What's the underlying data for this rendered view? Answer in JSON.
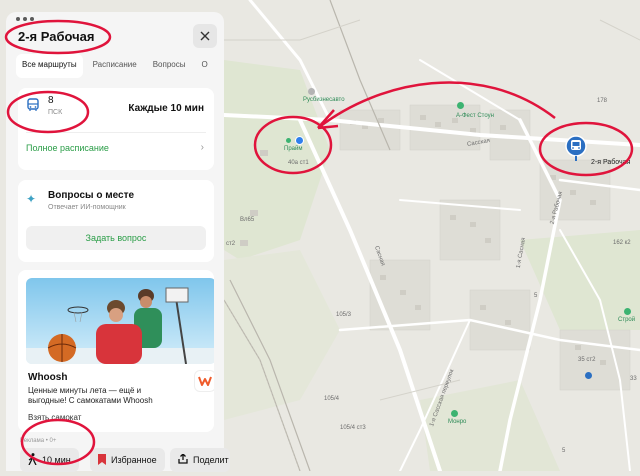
{
  "panel": {
    "title": "2-я Рабочая",
    "tabs": [
      "Все маршруты",
      "Расписание",
      "Вопросы",
      "О"
    ],
    "route": {
      "number": "8",
      "type": "ПСК",
      "frequency": "Каждые 10 мин",
      "schedule_link": "Полное расписание"
    },
    "questions": {
      "title": "Вопросы о месте",
      "subtitle": "Отвечает ИИ-помощник",
      "button": "Задать вопрос"
    },
    "ad": {
      "title": "Whoosh",
      "text": "Ценные минуты лета — ещё и выгодные! С самокатами Whoosh",
      "link": "Взять самокат",
      "note": "Реклама • 0+"
    },
    "bottom": {
      "walk": "10 мин",
      "favorite": "Избранное",
      "share": "Поделит"
    }
  },
  "map": {
    "labels": {
      "rusbiz": "Русбизнесавто",
      "praim": "Прайм",
      "house40a": "40а ст1",
      "afest": "А-Фест Стоун",
      "house178": "178",
      "stop_name": "2-я Рабочая",
      "house65": "Вл65",
      "street1": "Сасная",
      "street2": "Сасская",
      "street3": "2-я Рабочая",
      "street4": "1-я Сасная",
      "street5": "1-я Сасская переулок",
      "house1": "105/3",
      "house2": "105/4",
      "house3": "105/4 ст3",
      "house4": "35 ст2",
      "house5": "33",
      "house6": "162 к2",
      "house7": "5",
      "house8": "ст2",
      "monro": "Монро",
      "stroy": "Строй",
      "building1": "5"
    }
  }
}
